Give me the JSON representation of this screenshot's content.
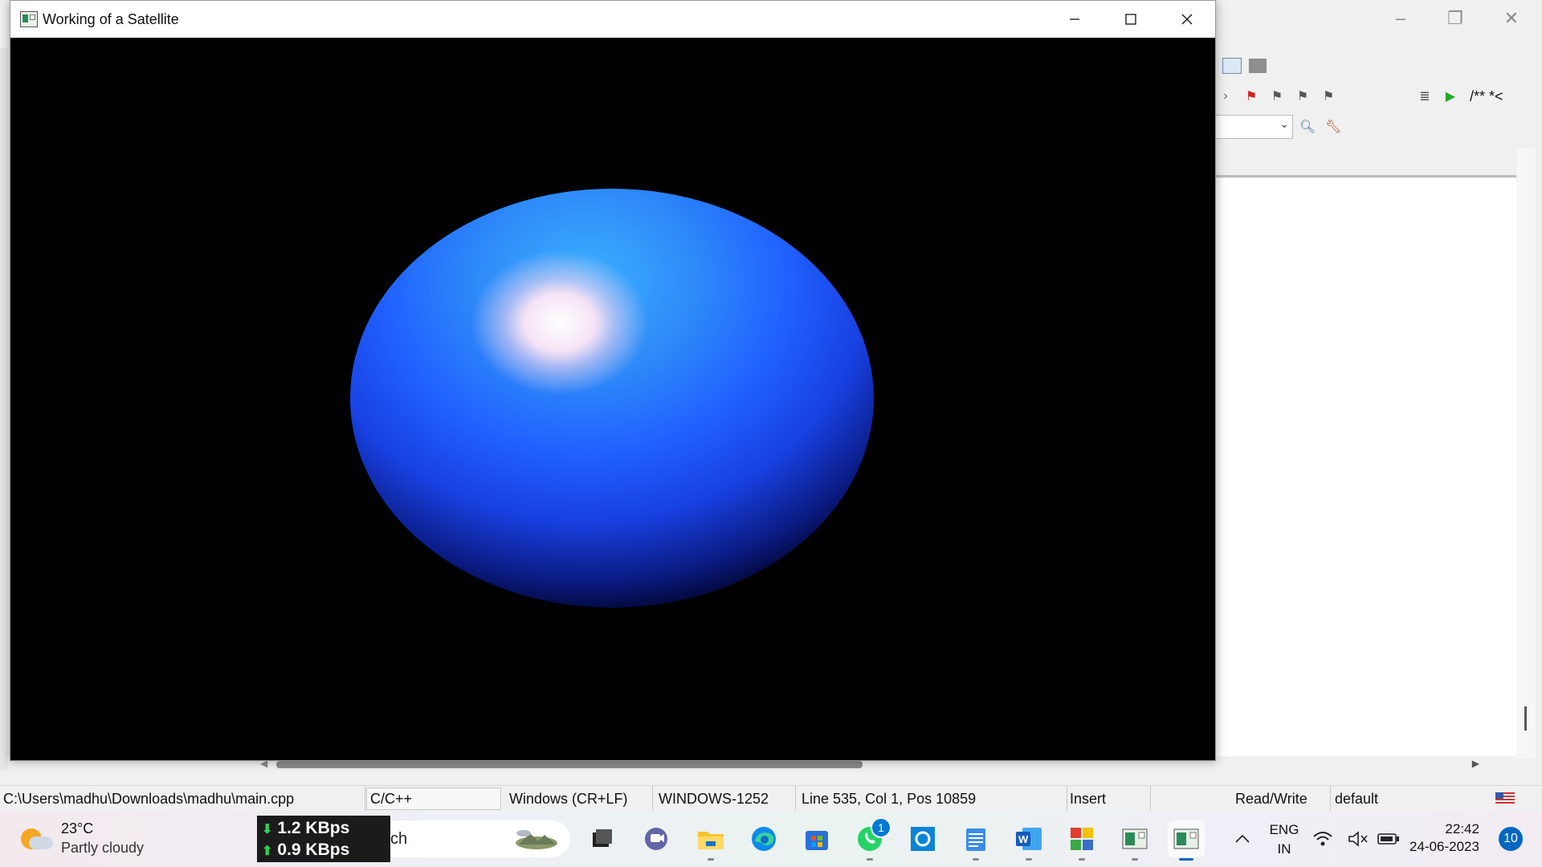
{
  "window": {
    "title": "Working of a Satellite",
    "minimize": "—",
    "maximize": "☐",
    "close": "✕"
  },
  "editor": {
    "toolbar_comment": "/** *<"
  },
  "statusbar": {
    "path": "C:\\Users\\madhu\\Downloads\\madhu\\main.cpp",
    "language": "C/C++",
    "eol": "Windows (CR+LF)",
    "encoding": "WINDOWS-1252",
    "position": "Line 535, Col 1, Pos 10859",
    "mode": "Insert",
    "access": "Read/Write",
    "profile": "default"
  },
  "taskbar": {
    "weather_temp": "23°C",
    "weather_desc": "Partly cloudy",
    "net_down": "1.2 KBps",
    "net_up": "0.9 KBps",
    "search_text": "ch",
    "whatsapp_badge": "1",
    "lang_top": "ENG",
    "lang_bottom": "IN",
    "time": "22:42",
    "date": "24-06-2023",
    "notifications": "10"
  }
}
